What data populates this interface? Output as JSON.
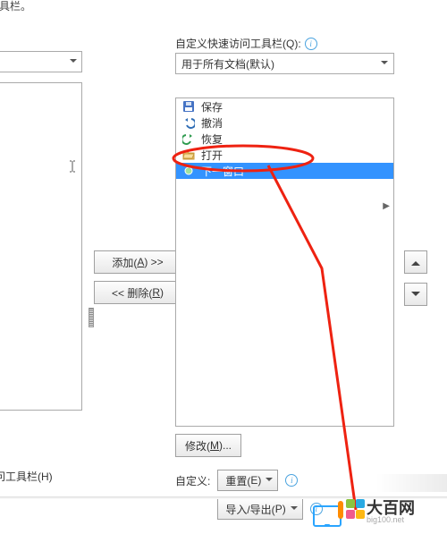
{
  "fragments": {
    "topLeft": "具栏。"
  },
  "leftCombo": {
    "value": ""
  },
  "right": {
    "label_prefix": "自定义快速访问工具栏(",
    "label_u": "Q",
    "label_suffix": "):",
    "combo": {
      "value": "用于所有文档(默认)"
    }
  },
  "qat_items": [
    {
      "icon": "save-icon",
      "label": "保存",
      "selected": false
    },
    {
      "icon": "undo-icon",
      "label": "撤消",
      "selected": false
    },
    {
      "icon": "redo-icon",
      "label": "恢复",
      "selected": false
    },
    {
      "icon": "open-icon",
      "label": "打开",
      "selected": false
    },
    {
      "icon": "window-icon",
      "label": "下一窗口",
      "selected": true
    }
  ],
  "buttons": {
    "add_prefix": "添加(",
    "add_u": "A",
    "add_suffix": ") >>",
    "remove_prefix": "<< 删除(",
    "remove_u": "R",
    "remove_suffix": ")",
    "modify_prefix": "修改(",
    "modify_u": "M",
    "modify_suffix": ")..."
  },
  "bottom": {
    "custom_label": "自定义:",
    "reset_prefix": "重置(",
    "reset_u": "E",
    "reset_suffix": ")",
    "io_prefix": "导入/导出(",
    "io_u": "P",
    "io_suffix": ")"
  },
  "leftLink": {
    "prefix": "问工具栏(",
    "u": "H",
    "suffix": ")"
  },
  "watermark": {
    "big": "大百网",
    "small": "big100.net"
  }
}
